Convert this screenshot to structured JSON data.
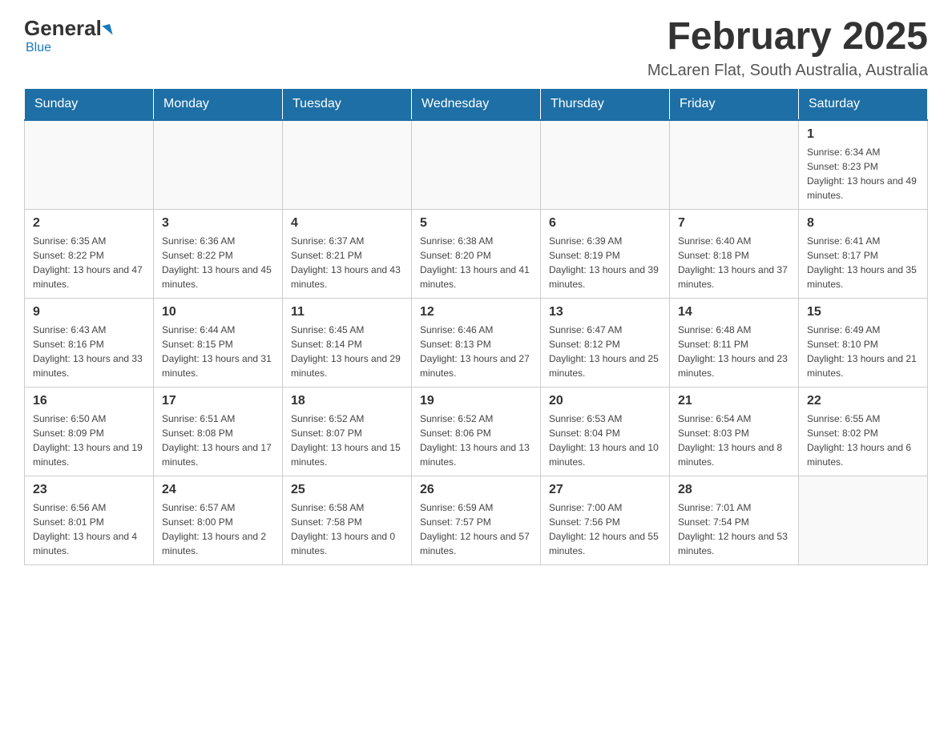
{
  "header": {
    "logo_general": "General",
    "logo_blue": "Blue",
    "title": "February 2025",
    "subtitle": "McLaren Flat, South Australia, Australia"
  },
  "days_of_week": [
    "Sunday",
    "Monday",
    "Tuesday",
    "Wednesday",
    "Thursday",
    "Friday",
    "Saturday"
  ],
  "weeks": [
    [
      {
        "day": "",
        "info": ""
      },
      {
        "day": "",
        "info": ""
      },
      {
        "day": "",
        "info": ""
      },
      {
        "day": "",
        "info": ""
      },
      {
        "day": "",
        "info": ""
      },
      {
        "day": "",
        "info": ""
      },
      {
        "day": "1",
        "info": "Sunrise: 6:34 AM\nSunset: 8:23 PM\nDaylight: 13 hours and 49 minutes."
      }
    ],
    [
      {
        "day": "2",
        "info": "Sunrise: 6:35 AM\nSunset: 8:22 PM\nDaylight: 13 hours and 47 minutes."
      },
      {
        "day": "3",
        "info": "Sunrise: 6:36 AM\nSunset: 8:22 PM\nDaylight: 13 hours and 45 minutes."
      },
      {
        "day": "4",
        "info": "Sunrise: 6:37 AM\nSunset: 8:21 PM\nDaylight: 13 hours and 43 minutes."
      },
      {
        "day": "5",
        "info": "Sunrise: 6:38 AM\nSunset: 8:20 PM\nDaylight: 13 hours and 41 minutes."
      },
      {
        "day": "6",
        "info": "Sunrise: 6:39 AM\nSunset: 8:19 PM\nDaylight: 13 hours and 39 minutes."
      },
      {
        "day": "7",
        "info": "Sunrise: 6:40 AM\nSunset: 8:18 PM\nDaylight: 13 hours and 37 minutes."
      },
      {
        "day": "8",
        "info": "Sunrise: 6:41 AM\nSunset: 8:17 PM\nDaylight: 13 hours and 35 minutes."
      }
    ],
    [
      {
        "day": "9",
        "info": "Sunrise: 6:43 AM\nSunset: 8:16 PM\nDaylight: 13 hours and 33 minutes."
      },
      {
        "day": "10",
        "info": "Sunrise: 6:44 AM\nSunset: 8:15 PM\nDaylight: 13 hours and 31 minutes."
      },
      {
        "day": "11",
        "info": "Sunrise: 6:45 AM\nSunset: 8:14 PM\nDaylight: 13 hours and 29 minutes."
      },
      {
        "day": "12",
        "info": "Sunrise: 6:46 AM\nSunset: 8:13 PM\nDaylight: 13 hours and 27 minutes."
      },
      {
        "day": "13",
        "info": "Sunrise: 6:47 AM\nSunset: 8:12 PM\nDaylight: 13 hours and 25 minutes."
      },
      {
        "day": "14",
        "info": "Sunrise: 6:48 AM\nSunset: 8:11 PM\nDaylight: 13 hours and 23 minutes."
      },
      {
        "day": "15",
        "info": "Sunrise: 6:49 AM\nSunset: 8:10 PM\nDaylight: 13 hours and 21 minutes."
      }
    ],
    [
      {
        "day": "16",
        "info": "Sunrise: 6:50 AM\nSunset: 8:09 PM\nDaylight: 13 hours and 19 minutes."
      },
      {
        "day": "17",
        "info": "Sunrise: 6:51 AM\nSunset: 8:08 PM\nDaylight: 13 hours and 17 minutes."
      },
      {
        "day": "18",
        "info": "Sunrise: 6:52 AM\nSunset: 8:07 PM\nDaylight: 13 hours and 15 minutes."
      },
      {
        "day": "19",
        "info": "Sunrise: 6:52 AM\nSunset: 8:06 PM\nDaylight: 13 hours and 13 minutes."
      },
      {
        "day": "20",
        "info": "Sunrise: 6:53 AM\nSunset: 8:04 PM\nDaylight: 13 hours and 10 minutes."
      },
      {
        "day": "21",
        "info": "Sunrise: 6:54 AM\nSunset: 8:03 PM\nDaylight: 13 hours and 8 minutes."
      },
      {
        "day": "22",
        "info": "Sunrise: 6:55 AM\nSunset: 8:02 PM\nDaylight: 13 hours and 6 minutes."
      }
    ],
    [
      {
        "day": "23",
        "info": "Sunrise: 6:56 AM\nSunset: 8:01 PM\nDaylight: 13 hours and 4 minutes."
      },
      {
        "day": "24",
        "info": "Sunrise: 6:57 AM\nSunset: 8:00 PM\nDaylight: 13 hours and 2 minutes."
      },
      {
        "day": "25",
        "info": "Sunrise: 6:58 AM\nSunset: 7:58 PM\nDaylight: 13 hours and 0 minutes."
      },
      {
        "day": "26",
        "info": "Sunrise: 6:59 AM\nSunset: 7:57 PM\nDaylight: 12 hours and 57 minutes."
      },
      {
        "day": "27",
        "info": "Sunrise: 7:00 AM\nSunset: 7:56 PM\nDaylight: 12 hours and 55 minutes."
      },
      {
        "day": "28",
        "info": "Sunrise: 7:01 AM\nSunset: 7:54 PM\nDaylight: 12 hours and 53 minutes."
      },
      {
        "day": "",
        "info": ""
      }
    ]
  ]
}
